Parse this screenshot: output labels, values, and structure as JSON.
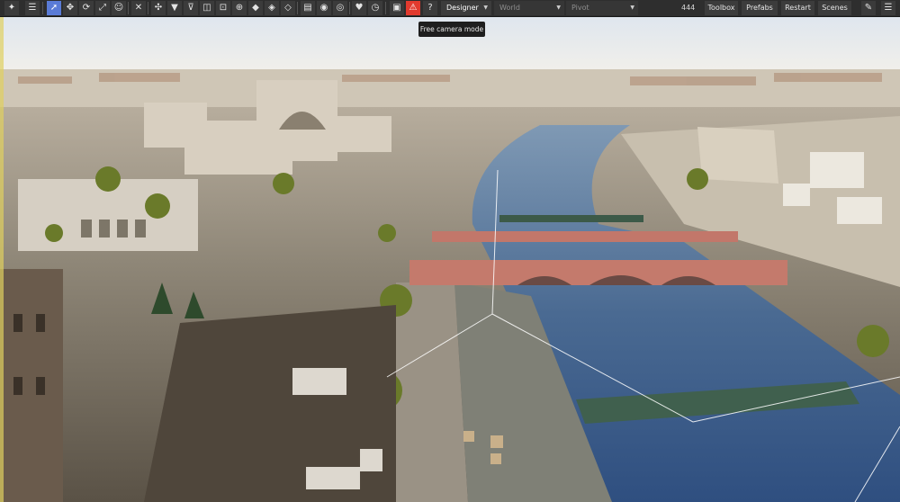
{
  "toolbar": {
    "mode": "Designer",
    "coord_space": "World",
    "pivot": "Pivot",
    "object_count": "444",
    "toolbox_label": "Toolbox",
    "prefabs_label": "Prefabs",
    "restart_label": "Restart",
    "scenes_label": "Scenes"
  },
  "tooltip": {
    "text": "Free camera mode"
  },
  "colors": {
    "active_tool": "#5a7bd6",
    "alert": "#e23a2e",
    "toolbar_bg": "#2e2e2e"
  }
}
